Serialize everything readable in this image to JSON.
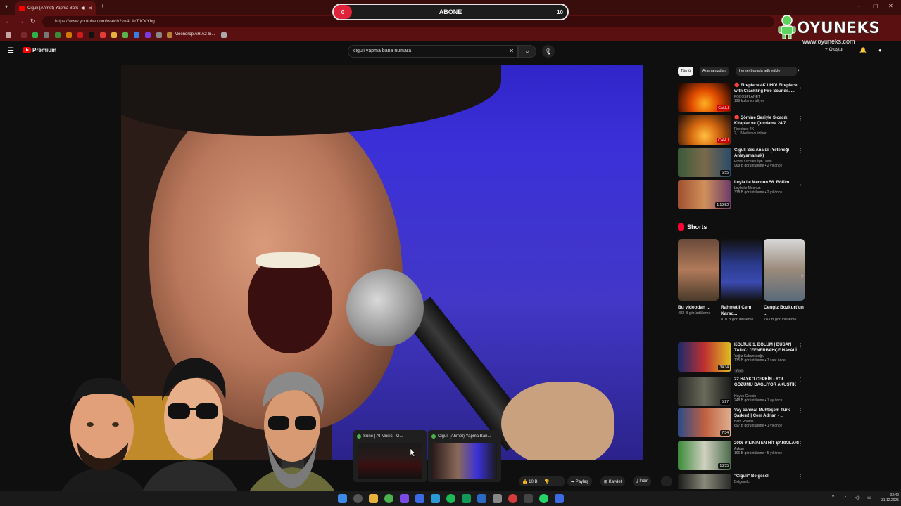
{
  "browser": {
    "tab_title": "Ciguli (Ahmet) Yapma Bana...",
    "url": "https://www.youtube.com/watch?v=4LArT1OrYhg",
    "bookmark_label": "Moondrop ARIA2 In..."
  },
  "youtube": {
    "brand": "Premium",
    "search_value": "ciguli yapma bana numara",
    "create_label": "Oluştur"
  },
  "overlay": {
    "abone_left": "0",
    "abone_label": "ABONE",
    "abone_right": "10",
    "brand_name": "OYUNEKS",
    "brand_site": "www.oyuneks.com"
  },
  "chips": [
    "Tümü",
    "Aramanızdan",
    "herşeyburada adlı yükle"
  ],
  "sidebar": [
    {
      "title": "🔴 Fireplace 4K UHD! Fireplace with Crackling Fire Sounds. ...",
      "channel": "FOBOSPLANET",
      "stats": "199 kullanıcı izliyor",
      "badge": "CANLI"
    },
    {
      "title": "🔴 Şömine Sesiyle Sıcacık Kitaplar ve Çıtırdama 24/7 ...",
      "channel": "Fireplace 4K",
      "stats": "2,1 B kullanıcı izliyor",
      "badge": "CANLI"
    },
    {
      "title": "Ciguli Ses Analizi (Yeteneği Anlayamamak)",
      "channel": "Emre Yücelen İşin Dersi",
      "stats": "969 B görüntüleme • 2 yıl önce",
      "badge": "6:55"
    },
    {
      "title": "Leyla ile Mecnun 56. Bölüm",
      "channel": "Leyla ile Mecnun",
      "stats": "338 B görüntüleme • 2 yıl önce",
      "badge": "1:19:52"
    }
  ],
  "shorts": {
    "heading": "Shorts",
    "items": [
      {
        "title": "Bu videodan ...",
        "views": "482 B görüntüleme"
      },
      {
        "title": "Rahmetli Cem Karac...",
        "views": "810 B görüntüleme"
      },
      {
        "title": "Cengiz Bozkurt'un ...",
        "views": "783 B görüntüleme"
      }
    ]
  },
  "sidebar2": [
    {
      "title": "KOLTUK 1. BÖLÜM | DUSAN TADIC: \"FENERBAHÇE HAYALİ...",
      "channel": "Yağız Sabuncuoğlu",
      "stats": "135 B görüntüleme • 7 saat önce",
      "badge": "34:34",
      "extra": "Yeni"
    },
    {
      "title": "22 HAYKO CEPKİN - YOL GÖZÜMÜ DAĞLIYOR AKUSTİK ...",
      "channel": "Hayko Cepkin",
      "stats": "248 B görüntüleme • 1 ay önce",
      "badge": "5:27"
    },
    {
      "title": "Vay canına! Muhteşem Türk Şarkısı! | Cem Adrian - ...",
      "channel": "Beth Rooms",
      "stats": "697 B görüntüleme • 1 yıl önce",
      "badge": "7:34"
    },
    {
      "title": "2006 YILININ EN HİT ŞARKILARI",
      "channel": "Aykan",
      "stats": "166 B görüntüleme • 5 yıl önce",
      "badge": "13:55"
    },
    {
      "title": "\"Ciguli\" Belgeseli",
      "channel": "Belgeselci",
      "stats": "",
      "badge": ""
    }
  ],
  "actions": {
    "likes": "10 B",
    "share": "Paylaş",
    "save": "Kaydet",
    "download": "İndir"
  },
  "switcher": [
    {
      "title": "Suno | AI Music - G..."
    },
    {
      "title": "Ciguli (Ahmet) Yapma Ban..."
    }
  ],
  "taskbar": {
    "time": "03:40",
    "date": "31.12.2025"
  },
  "colors": {
    "browser_frame": "#5a1010",
    "accent_red": "#ff0000",
    "abone_red": "#e0223a",
    "video_blue": "#3b30d8"
  }
}
